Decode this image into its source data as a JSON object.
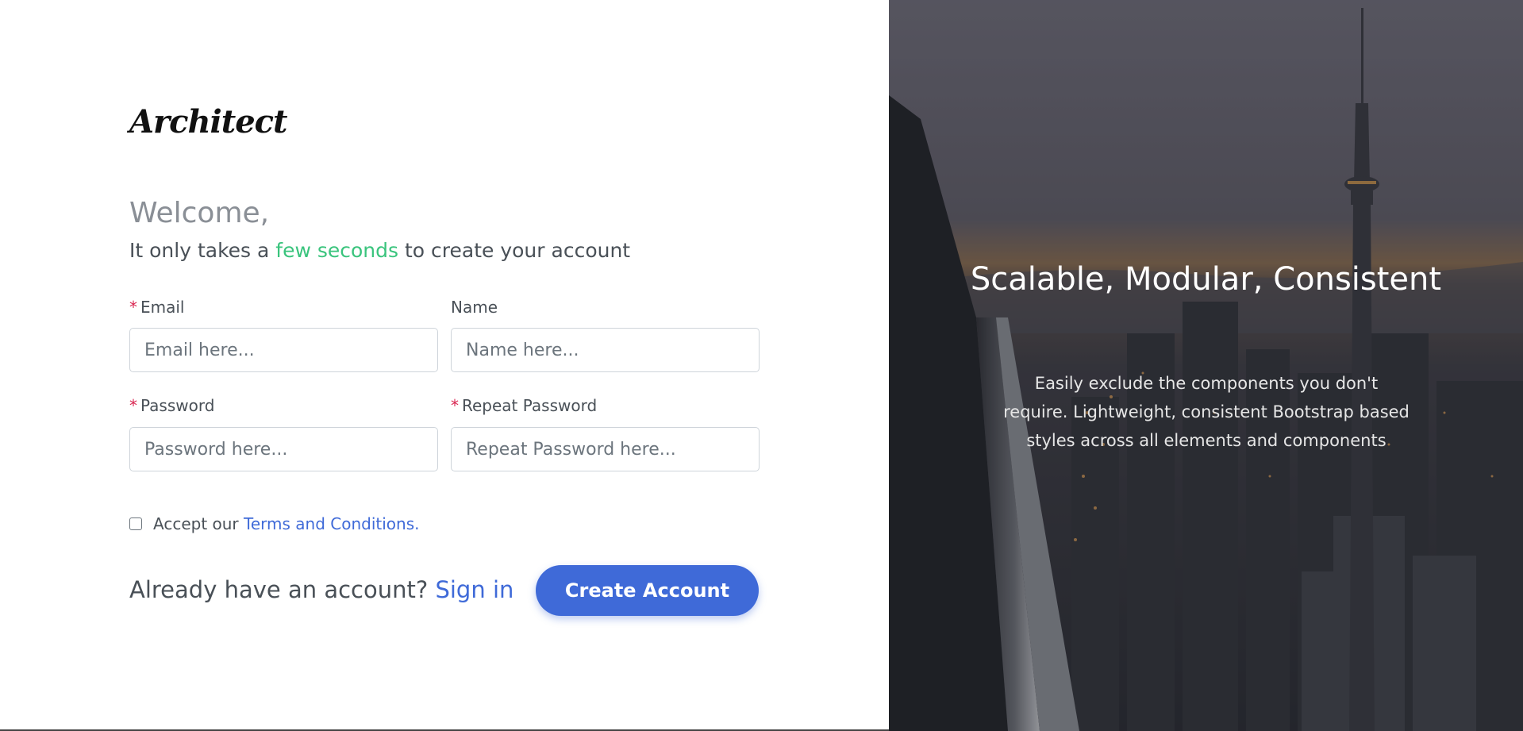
{
  "brand": {
    "logo_text": "Architect"
  },
  "header": {
    "welcome": "Welcome,",
    "subtitle_before": "It only takes a ",
    "subtitle_highlight": "few seconds",
    "subtitle_after": " to create your account"
  },
  "form": {
    "required_marker": "*",
    "email": {
      "label": "Email",
      "placeholder": "Email here...",
      "required": true
    },
    "name": {
      "label": "Name",
      "placeholder": "Name here...",
      "required": false
    },
    "password": {
      "label": "Password",
      "placeholder": "Password here...",
      "required": true
    },
    "repeat_password": {
      "label": "Repeat Password",
      "placeholder": "Repeat Password here...",
      "required": true
    },
    "terms": {
      "prefix": "Accept our ",
      "link": "Terms and Conditions",
      "suffix": ".",
      "checked": false
    },
    "signin_prompt": "Already have an account? ",
    "signin_link": "Sign in",
    "submit_label": "Create Account"
  },
  "slide": {
    "title": "Scalable, Modular, Consistent",
    "text": "Easily exclude the components you don't require. Lightweight, consistent Bootstrap based styles across all elements and components"
  },
  "colors": {
    "accent": "#3f6ad8",
    "highlight": "#3ac47d",
    "required": "#d92550",
    "muted": "#8a8f96"
  }
}
